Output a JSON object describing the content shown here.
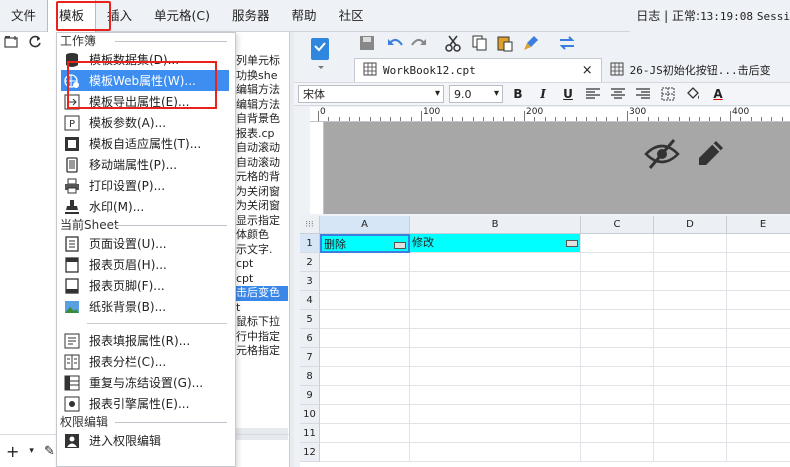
{
  "menubar": {
    "items": [
      "文件",
      "模板",
      "插入",
      "单元格(C)",
      "服务器",
      "帮助",
      "社区"
    ],
    "status": {
      "log": "日志",
      "sep": "|",
      "state": "正常:",
      "time": "13:19:08",
      "session": "Sessi"
    }
  },
  "dropdown": {
    "sections": {
      "workbook": "工作簿",
      "current_sheet": "当前Sheet",
      "permission": "权限编辑"
    },
    "workbook_items": [
      "模板数据集(D)...",
      "模板Web属性(W)...",
      "模板导出属性(E)...",
      "模板参数(A)...",
      "模板自适应属性(T)...",
      "移动端属性(P)...",
      "打印设置(P)...",
      "水印(M)..."
    ],
    "sheet_items": [
      "页面设置(U)...",
      "报表页眉(H)...",
      "报表页脚(F)...",
      "纸张背景(B)...",
      "报表填报属性(R)...",
      "报表分栏(C)...",
      "重复与冻结设置(G)...",
      "报表引擎属性(E)..."
    ],
    "permission_items": [
      "进入权限编辑"
    ]
  },
  "left_panel": {
    "bg_items": [
      "列单元标",
      "功换she",
      "编辑方法",
      "编辑方法",
      "自背景色",
      "报表.cp",
      "自动滚动",
      "自动滚动",
      "元格的背",
      "为关闭窗",
      "为关闭窗",
      "显示指定",
      "体颜色",
      "示文字.",
      "cpt",
      "cpt",
      "击后变色",
      "t",
      "鼠标下拉",
      "行中指定",
      "元格指定"
    ],
    "selected_index": 16
  },
  "tabs": [
    {
      "label": "WorkBook12.cpt",
      "close": "×"
    },
    {
      "label": "26-JS初始化按钮...击后变"
    }
  ],
  "format_bar": {
    "font": "宋体",
    "size": "9.0",
    "bold": "B",
    "italic": "I",
    "underline": "U",
    "color_letter": "A"
  },
  "ruler": {
    "labels": [
      "0",
      "100",
      "200",
      "300",
      "400"
    ]
  },
  "sheet": {
    "columns": [
      "A",
      "B",
      "C",
      "D",
      "E"
    ],
    "rows": [
      "1",
      "2",
      "3",
      "4",
      "5",
      "6",
      "7",
      "8",
      "9",
      "10",
      "11",
      "12"
    ],
    "cells": {
      "A1": "删除",
      "B1": "修改"
    }
  },
  "colors": {
    "highlight": "#e8231c",
    "menu_hover": "#3d8ef0",
    "cell_fill": "#00ffff"
  }
}
